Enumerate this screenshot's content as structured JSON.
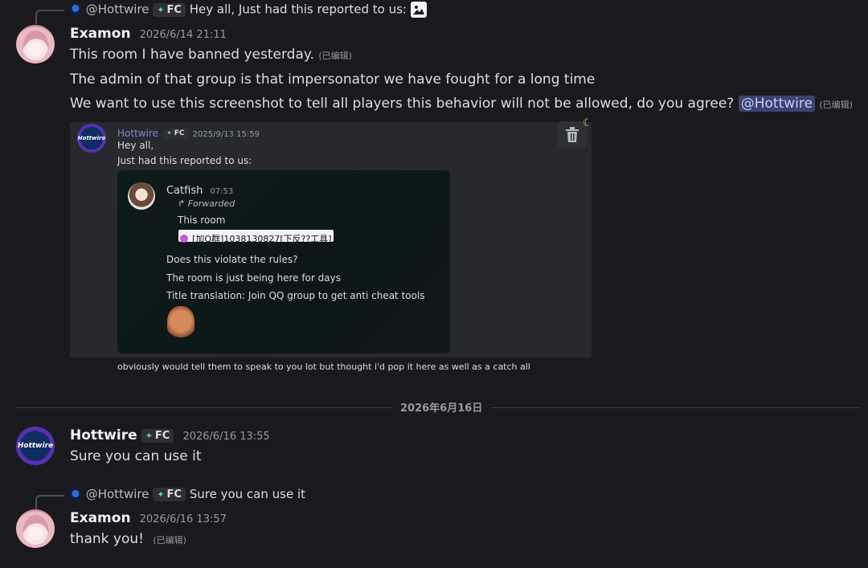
{
  "reply1": {
    "mention": "@Hottwire",
    "tag": "FC",
    "text": "Hey all, Just had this reported to us:"
  },
  "msg1": {
    "author": "Examon",
    "timestamp": "2026/6/14 21:11",
    "line1": "This room I have banned yesterday.",
    "edited1": "(已编辑)",
    "line2": "The admin of that group is that impersonator we have fought for a long time",
    "line3": "We want to use this screenshot to tell all players this behavior will not be allowed, do you agree?",
    "mention": "@Hottwire",
    "edited3": "(已编辑)"
  },
  "embed": {
    "author": "Hottwire",
    "tag": "FC",
    "timestamp": "2025/9/13 15:59",
    "line1": "Hey all,",
    "line2": "Just had this reported to us:",
    "footer": "obviously would tell them to speak to you lot but thought i'd pop it here as well as a catch all",
    "inner": {
      "author": "Catfish",
      "time": "07:53",
      "forwarded": "Forwarded",
      "room": "This room",
      "room_title": "[加Q群]1038130827[下反??工具]",
      "q1": "Does this violate the rules?",
      "q2": "The room is just being here for days",
      "q3": "Title translation: Join QQ group to get anti cheat tools"
    }
  },
  "date_divider": "2026年6月16日",
  "msg2": {
    "author": "Hottwire",
    "tag": "FC",
    "timestamp": "2026/6/16 13:55",
    "text": "Sure you can use it"
  },
  "reply2": {
    "mention": "@Hottwire",
    "tag": "FC",
    "text": "Sure you can use it"
  },
  "msg3": {
    "author": "Examon",
    "timestamp": "2026/6/16 13:57",
    "text": "thank you!",
    "edited": "(已编辑)"
  },
  "avatar_hot_label": "Hottwire",
  "colors": {
    "background": "#1a1a1e",
    "mention_bg": "#3c4270",
    "mention_fg": "#c9cdfb",
    "tag_icon": "#56d6a8"
  }
}
